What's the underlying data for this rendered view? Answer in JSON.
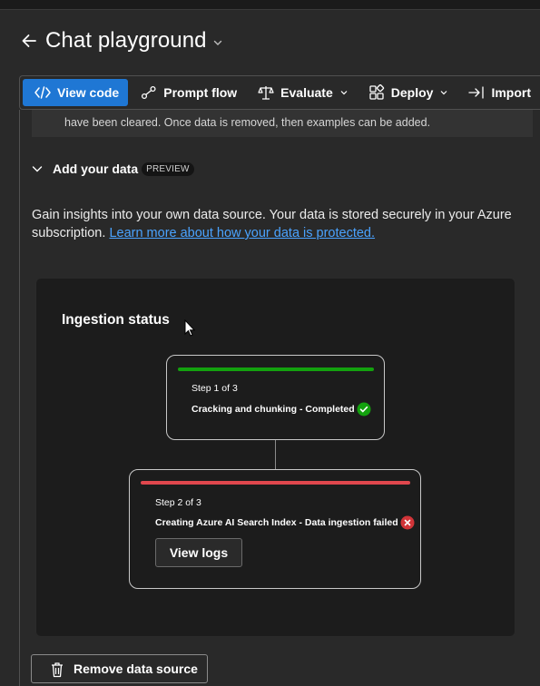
{
  "header": {
    "title": "Chat playground"
  },
  "toolbar": {
    "view_code": "View code",
    "prompt_flow": "Prompt flow",
    "evaluate": "Evaluate",
    "deploy": "Deploy",
    "import": "Import"
  },
  "notice": {
    "text": "have been cleared. Once data is removed, then examples can be added."
  },
  "section": {
    "title": "Add your data",
    "badge": "PREVIEW"
  },
  "description": {
    "text": "Gain insights into your own data source. Your data is stored securely in your Azure subscription. ",
    "link": "Learn more about how your data is protected."
  },
  "ingestion": {
    "title": "Ingestion status",
    "steps": [
      {
        "label": "Step 1 of 3",
        "description": "Cracking and chunking - Completed",
        "status": "completed",
        "color": "#13a10e"
      },
      {
        "label": "Step 2 of 3",
        "description": "Creating Azure AI Search Index - Data ingestion failed",
        "status": "failed",
        "color": "#e0474d",
        "action": "View logs"
      }
    ]
  },
  "footer": {
    "remove_label": "Remove data source"
  },
  "colors": {
    "accent": "#1f77d4",
    "link": "#4aa3ff",
    "success": "#13a10e",
    "error": "#d13438"
  }
}
